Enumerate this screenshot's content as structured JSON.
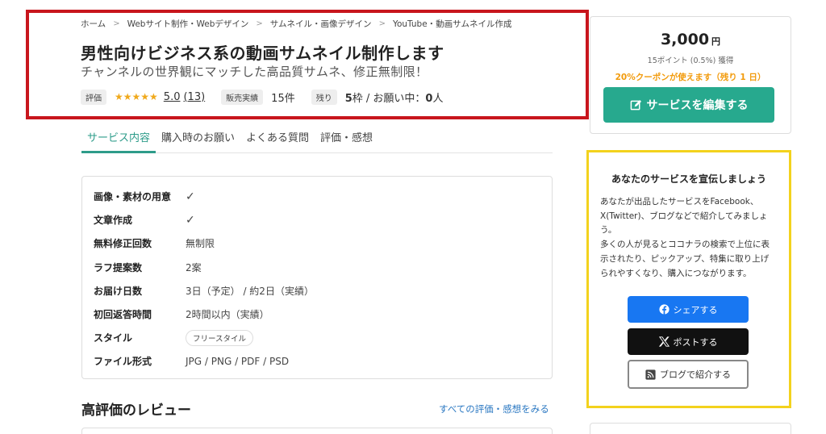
{
  "breadcrumb": [
    "ホーム",
    "Webサイト制作・Webデザイン",
    "サムネイル・画像デザイン",
    "YouTube・動画サムネイル作成"
  ],
  "service": {
    "title": "男性向けビジネス系の動画サムネイル制作します",
    "subtitle": "チャンネルの世界観にマッチした高品質サムネ、修正無制限！",
    "rating_label": "評価",
    "stars": "★★★★★",
    "rating_value": "5.0",
    "rating_count": "(13)",
    "sales_label": "販売実績",
    "sales_value": "15件",
    "remaining_label": "残り",
    "remaining_slots": "5",
    "remaining_unit": "枠 / お願い中：",
    "in_progress": "0",
    "in_progress_unit": "人"
  },
  "tabs": [
    "サービス内容",
    "購入時のお願い",
    "よくある質問",
    "評価・感想"
  ],
  "specs": [
    {
      "key": "画像・素材の用意",
      "value": "✓",
      "type": "check"
    },
    {
      "key": "文章作成",
      "value": "✓",
      "type": "check"
    },
    {
      "key": "無料修正回数",
      "value": "無制限",
      "type": "text"
    },
    {
      "key": "ラフ提案数",
      "value": "2案",
      "type": "text"
    },
    {
      "key": "お届け日数",
      "value": "3日（予定） / 約2日（実績）",
      "type": "text"
    },
    {
      "key": "初回返答時間",
      "value": "2時間以内（実績）",
      "type": "text"
    },
    {
      "key": "スタイル",
      "value": "フリースタイル",
      "type": "pill"
    },
    {
      "key": "ファイル形式",
      "value": "JPG / PNG / PDF / PSD",
      "type": "text"
    }
  ],
  "reviews": {
    "title": "高評価のレビュー",
    "see_all": "すべての評価・感想をみる"
  },
  "purchase": {
    "price": "3,000",
    "unit": "円",
    "points": "15ポイント (0.5%) 獲得",
    "coupon": "20%クーポンが使えます（残り 1 日）",
    "edit_button": "サービスを編集する"
  },
  "promo": {
    "title": "あなたのサービスを宣伝しましょう",
    "body": [
      "あなたが出品したサービスをFacebook、",
      "X(Twitter)、ブログなどで紹介してみましょ",
      "う。",
      "多くの人が見るとココナラの検索で上位に表",
      "示されたり、ピックアップ、特集に取り上げ",
      "られやすくなり、購入につながります。"
    ],
    "share_fb": "シェアする",
    "share_x": "ポストする",
    "share_blog": "ブログで紹介する"
  },
  "colors": {
    "accent": "#27a98e",
    "facebook": "#1877f2",
    "x": "#111111",
    "highlight_red": "#c8161d",
    "highlight_yellow": "#f3d21d",
    "coupon": "#f29b0c"
  }
}
